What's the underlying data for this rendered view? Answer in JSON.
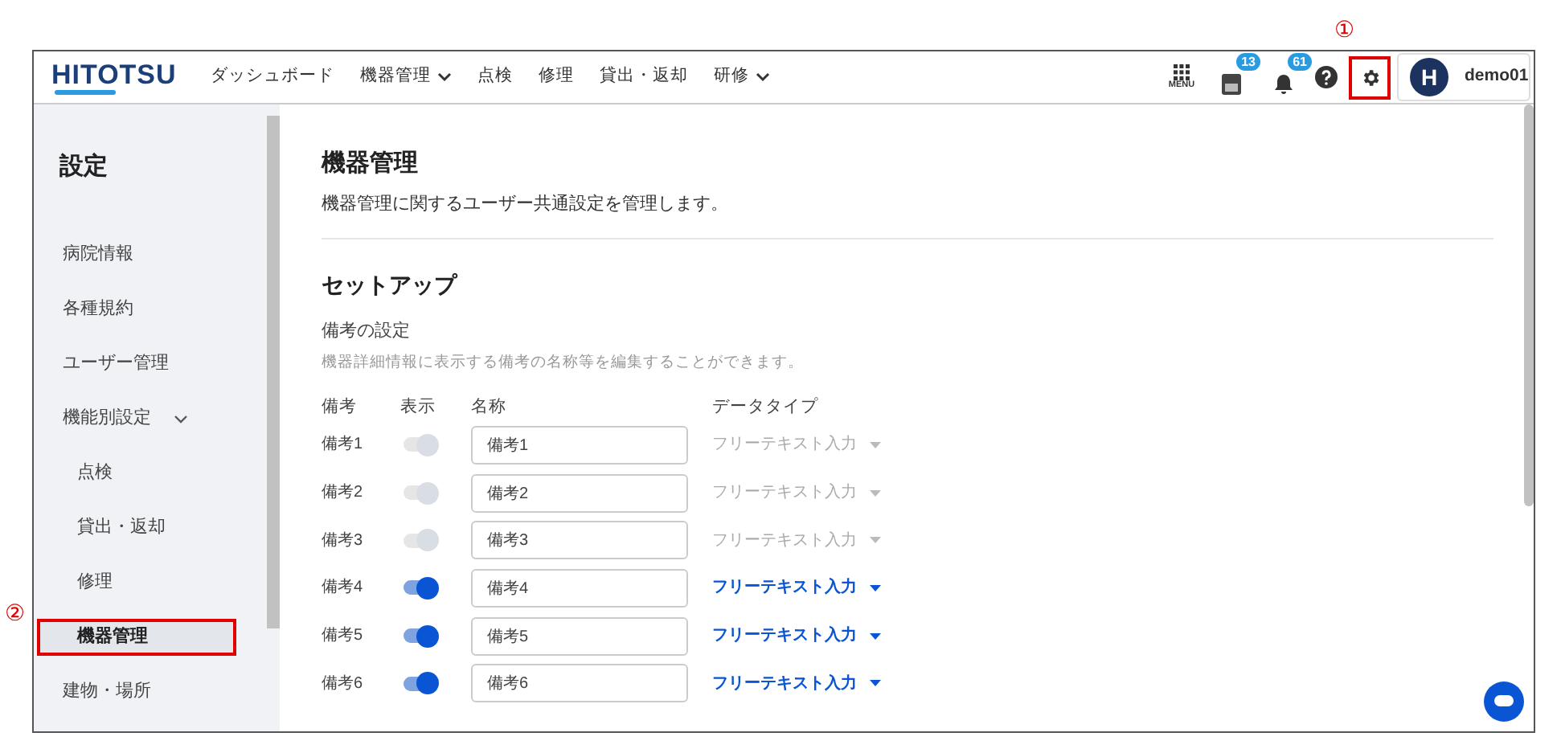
{
  "header": {
    "logo": "HITOTSU",
    "nav": [
      {
        "label": "ダッシュボード",
        "dropdown": false
      },
      {
        "label": "機器管理",
        "dropdown": true
      },
      {
        "label": "点検",
        "dropdown": false
      },
      {
        "label": "修理",
        "dropdown": false
      },
      {
        "label": "貸出・返却",
        "dropdown": false
      },
      {
        "label": "研修",
        "dropdown": true
      }
    ],
    "menu_label": "MENU",
    "pda_badge": "13",
    "bell_badge": "61",
    "settings_highlighted": true,
    "avatar_letter": "H",
    "user": "demo01"
  },
  "annotations": [
    {
      "text": "①"
    },
    {
      "text": "②"
    }
  ],
  "sidebar": {
    "title": "設定",
    "items": [
      {
        "label": "病院情報",
        "selected": false,
        "highlighted": false
      },
      {
        "label": "各種規約",
        "selected": false,
        "highlighted": false
      },
      {
        "label": "ユーザー管理",
        "selected": false,
        "highlighted": false
      },
      {
        "label": "機能別設定",
        "selected": false,
        "highlighted": false,
        "expanded": true,
        "children": [
          {
            "label": "点検",
            "selected": false,
            "highlighted": false
          },
          {
            "label": "貸出・返却",
            "selected": false,
            "highlighted": false
          },
          {
            "label": "修理",
            "selected": false,
            "highlighted": false
          },
          {
            "label": "機器管理",
            "selected": true,
            "highlighted": true
          }
        ]
      },
      {
        "label": "建物・場所",
        "selected": false,
        "highlighted": false
      }
    ]
  },
  "content": {
    "title": "機器管理",
    "description": "機器管理に関するユーザー共通設定を管理します。",
    "section": "セットアップ",
    "subsection": "備考の設定",
    "hint": "機器詳細情報に表示する備考の名称等を編集することができます。",
    "columns": [
      "備考",
      "表示",
      "名称",
      "データタイプ"
    ],
    "rows": [
      {
        "label": "備考1",
        "on": true,
        "disabled": true,
        "name": "備考1",
        "data_type": "フリーテキスト入力"
      },
      {
        "label": "備考2",
        "on": true,
        "disabled": true,
        "name": "備考2",
        "data_type": "フリーテキスト入力"
      },
      {
        "label": "備考3",
        "on": true,
        "disabled": true,
        "name": "備考3",
        "data_type": "フリーテキスト入力"
      },
      {
        "label": "備考4",
        "on": true,
        "disabled": false,
        "name": "備考4",
        "data_type": "フリーテキスト入力"
      },
      {
        "label": "備考5",
        "on": true,
        "disabled": false,
        "name": "備考5",
        "data_type": "フリーテキスト入力"
      },
      {
        "label": "備考6",
        "on": true,
        "disabled": false,
        "name": "備考6",
        "data_type": "フリーテキスト入力"
      }
    ]
  }
}
